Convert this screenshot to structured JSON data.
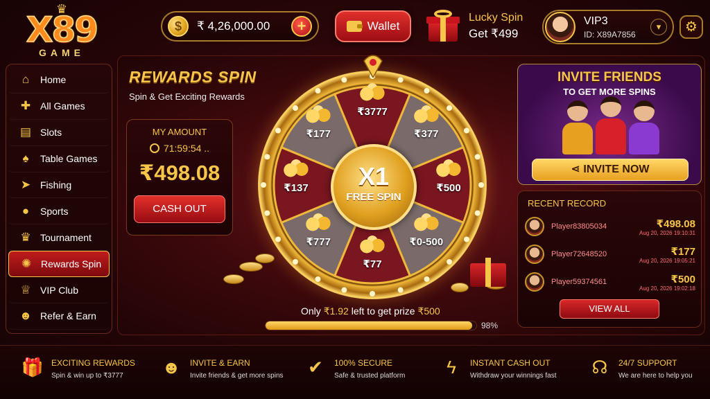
{
  "header": {
    "logo_main": "X89",
    "logo_sub": "GAME",
    "balance": "₹ 4,26,000.00",
    "coin_symbol": "$",
    "add_symbol": "+",
    "wallet_label": "Wallet",
    "lucky_title": "Lucky Spin",
    "lucky_sub": "Get ₹499",
    "vip_level": "VIP3",
    "user_id": "ID: X89A7856"
  },
  "sidebar": {
    "items": [
      {
        "label": "Home",
        "icon": "home-icon",
        "glyph": "⌂"
      },
      {
        "label": "All Games",
        "icon": "gamepad-icon",
        "glyph": "✚"
      },
      {
        "label": "Slots",
        "icon": "slots-icon",
        "glyph": "▤"
      },
      {
        "label": "Table Games",
        "icon": "cards-icon",
        "glyph": "♠"
      },
      {
        "label": "Fishing",
        "icon": "fish-icon",
        "glyph": "➤"
      },
      {
        "label": "Sports",
        "icon": "soccer-icon",
        "glyph": "●"
      },
      {
        "label": "Tournament",
        "icon": "trophy-icon",
        "glyph": "♛"
      },
      {
        "label": "Rewards Spin",
        "icon": "wheel-icon",
        "glyph": "✺"
      },
      {
        "label": "VIP Club",
        "icon": "crown-icon",
        "glyph": "♕"
      },
      {
        "label": "Refer & Earn",
        "icon": "people-icon",
        "glyph": "☻"
      }
    ],
    "active_index": 7
  },
  "rewards": {
    "title": "REWARDS SPIN",
    "subtitle": "Spin & Get Exciting Rewards",
    "my_amount_label": "MY AMOUNT",
    "timer": "71:59:54 ..",
    "amount": "₹498.08",
    "cash_out_label": "CASH OUT"
  },
  "wheel": {
    "hub_multiplier": "X1",
    "hub_text": "FREE SPIN",
    "segments": [
      "₹3777",
      "₹377",
      "₹500",
      "₹0-500",
      "₹77",
      "₹777",
      "₹137",
      "₹177"
    ],
    "colors": {
      "light": "#7a6a6a",
      "dark": "#7a1620"
    }
  },
  "progress": {
    "prefix": "Only ",
    "remaining": "₹1.92",
    "middle": " left to get prize ",
    "prize": "₹500",
    "percent_label": "98%",
    "fraction": 0.98
  },
  "invite": {
    "title": "INVITE FRIENDS",
    "subtitle": "TO GET MORE SPINS",
    "button_label": "INVITE NOW"
  },
  "recent": {
    "title": "RECENT RECORD",
    "rows": [
      {
        "name": "Player83805034",
        "amount": "₹498.08",
        "time": "Aug 20, 2026 19:10:31"
      },
      {
        "name": "Player72648520",
        "amount": "₹177",
        "time": "Aug 20, 2026 19:05:21"
      },
      {
        "name": "Player59374561",
        "amount": "₹500",
        "time": "Aug 20, 2026 19:02:18"
      }
    ],
    "view_all_label": "VIEW ALL"
  },
  "footer": {
    "features": [
      {
        "title": "EXCITING REWARDS",
        "desc": "Spin & win up to ₹3777",
        "icon": "gift-icon",
        "glyph": "🎁"
      },
      {
        "title": "INVITE & EARN",
        "desc": "Invite friends & get more spins",
        "icon": "people-icon",
        "glyph": "☻"
      },
      {
        "title": "100% SECURE",
        "desc": "Safe & trusted platform",
        "icon": "shield-icon",
        "glyph": "✔"
      },
      {
        "title": "INSTANT CASH OUT",
        "desc": "Withdraw your winnings fast",
        "icon": "lightning-icon",
        "glyph": "ϟ"
      },
      {
        "title": "24/7 SUPPORT",
        "desc": "We are here to help you",
        "icon": "headset-icon",
        "glyph": "☊"
      }
    ]
  }
}
